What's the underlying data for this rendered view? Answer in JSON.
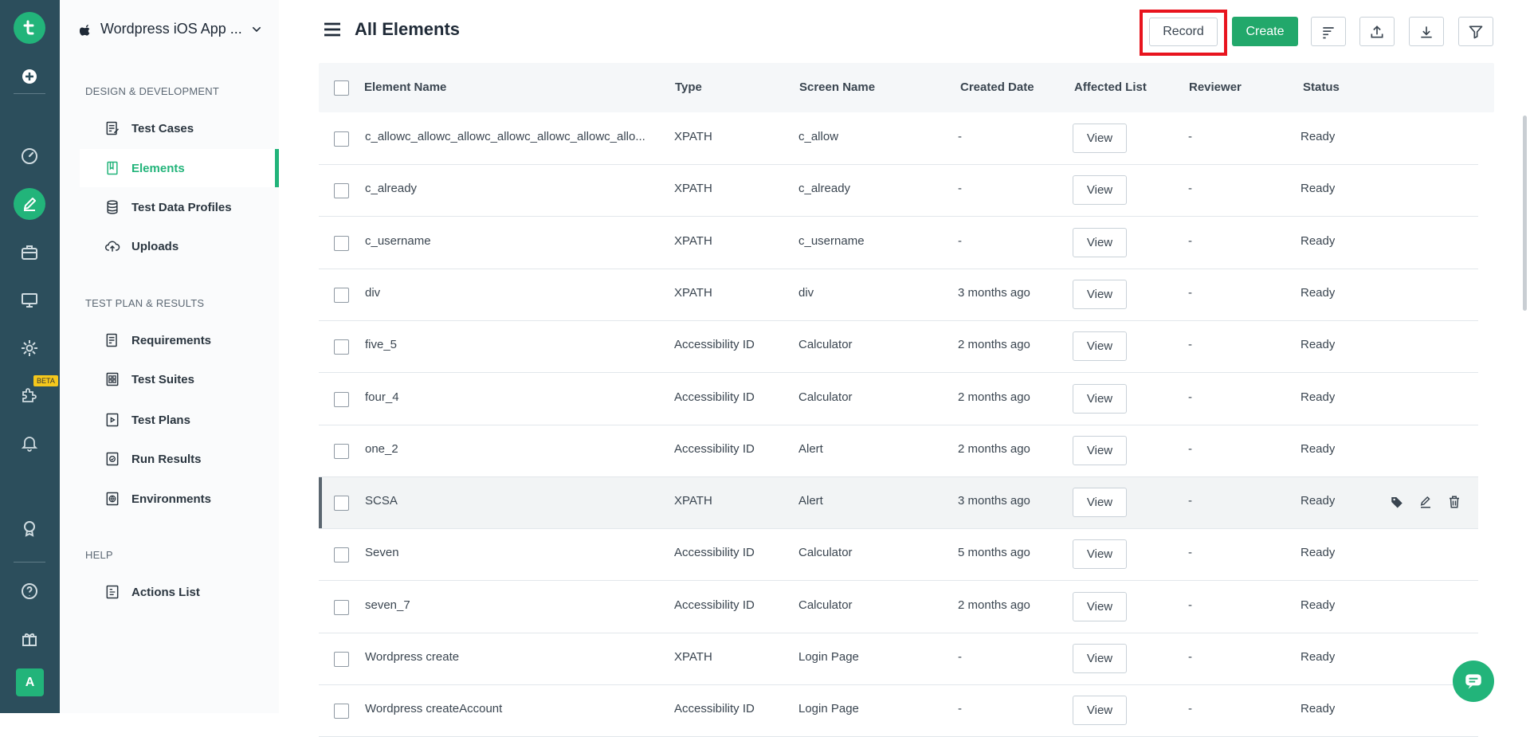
{
  "app": {
    "project_name": "Wordpress iOS App ...",
    "beta_badge": "BETA",
    "avatar_initial": "A"
  },
  "sidebar": {
    "sections": [
      {
        "title": "DESIGN & DEVELOPMENT",
        "items": [
          {
            "label": "Test Cases",
            "icon": "test-cases-icon"
          },
          {
            "label": "Elements",
            "icon": "elements-icon",
            "active": true
          },
          {
            "label": "Test Data Profiles",
            "icon": "database-icon"
          },
          {
            "label": "Uploads",
            "icon": "cloud-upload-icon"
          }
        ]
      },
      {
        "title": "TEST PLAN & RESULTS",
        "items": [
          {
            "label": "Requirements",
            "icon": "requirements-icon"
          },
          {
            "label": "Test Suites",
            "icon": "test-suites-icon"
          },
          {
            "label": "Test Plans",
            "icon": "test-plans-icon"
          },
          {
            "label": "Run Results",
            "icon": "run-results-icon"
          },
          {
            "label": "Environments",
            "icon": "globe-icon"
          }
        ]
      },
      {
        "title": "HELP",
        "items": [
          {
            "label": "Actions List",
            "icon": "actions-list-icon"
          }
        ]
      }
    ]
  },
  "header": {
    "title": "All Elements",
    "record_label": "Record",
    "create_label": "Create"
  },
  "table": {
    "columns": [
      "Element Name",
      "Type",
      "Screen Name",
      "Created Date",
      "Affected List",
      "Reviewer",
      "Status"
    ],
    "view_label": "View",
    "rows": [
      {
        "name": "c_allowc_allowc_allowc_allowc_allowc_allowc_allo...",
        "type": "XPATH",
        "screen": "c_allow",
        "created": "-",
        "reviewer": "-",
        "status": "Ready"
      },
      {
        "name": "c_already",
        "type": "XPATH",
        "screen": "c_already",
        "created": "-",
        "reviewer": "-",
        "status": "Ready"
      },
      {
        "name": "c_username",
        "type": "XPATH",
        "screen": "c_username",
        "created": "-",
        "reviewer": "-",
        "status": "Ready"
      },
      {
        "name": "div",
        "type": "XPATH",
        "screen": "div",
        "created": "3 months ago",
        "reviewer": "-",
        "status": "Ready"
      },
      {
        "name": "five_5",
        "type": "Accessibility ID",
        "screen": "Calculator",
        "created": "2 months ago",
        "reviewer": "-",
        "status": "Ready"
      },
      {
        "name": "four_4",
        "type": "Accessibility ID",
        "screen": "Calculator",
        "created": "2 months ago",
        "reviewer": "-",
        "status": "Ready"
      },
      {
        "name": "one_2",
        "type": "Accessibility ID",
        "screen": "Alert",
        "created": "2 months ago",
        "reviewer": "-",
        "status": "Ready"
      },
      {
        "name": "SCSA",
        "type": "XPATH",
        "screen": "Alert",
        "created": "3 months ago",
        "reviewer": "-",
        "status": "Ready",
        "hovered": true
      },
      {
        "name": "Seven",
        "type": "Accessibility ID",
        "screen": "Calculator",
        "created": "5 months ago",
        "reviewer": "-",
        "status": "Ready"
      },
      {
        "name": "seven_7",
        "type": "Accessibility ID",
        "screen": "Calculator",
        "created": "2 months ago",
        "reviewer": "-",
        "status": "Ready"
      },
      {
        "name": "Wordpress create",
        "type": "XPATH",
        "screen": "Login Page",
        "created": "-",
        "reviewer": "-",
        "status": "Ready"
      },
      {
        "name": "Wordpress createAccount",
        "type": "Accessibility ID",
        "screen": "Login Page",
        "created": "-",
        "reviewer": "-",
        "status": "Ready"
      }
    ]
  },
  "colors": {
    "brand": "#22b47a",
    "rail": "#2c4e5c",
    "highlight": "#e8141e"
  }
}
